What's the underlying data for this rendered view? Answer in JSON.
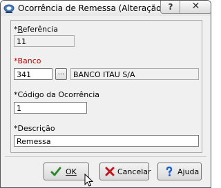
{
  "window": {
    "title": "Ocorrência de Remessa (Alteração)",
    "help_label": "?",
    "close_label": "✕"
  },
  "form": {
    "referencia": {
      "label": "Referência",
      "value": "11"
    },
    "banco": {
      "label": "Banco",
      "code": "341",
      "lookup_label": "...",
      "name": "BANCO ITAU S/A"
    },
    "codigo": {
      "label": "Código da Ocorrência",
      "value": "1"
    },
    "descricao": {
      "label": "Descrição",
      "value": "Remessa"
    }
  },
  "buttons": {
    "ok": "OK",
    "cancel": "Cancelar",
    "help": "Ajuda"
  },
  "colors": {
    "required_label": "#c00000",
    "ok_check": "#2a8a2a",
    "cancel_x": "#c0141e",
    "help_icon": "#1e5fc8"
  }
}
